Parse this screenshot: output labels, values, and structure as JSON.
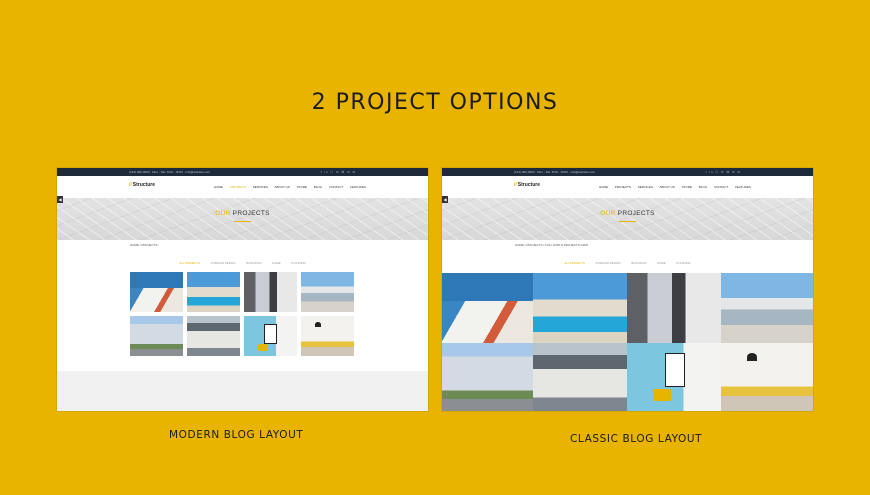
{
  "headline": "2 PROJECT OPTIONS",
  "captions": {
    "left": "MODERN BLOG LAYOUT",
    "right": "CLASSIC BLOG LAYOUT"
  },
  "site": {
    "contact_text": "(123) 000-0000 · Mon - Sat: 8:00 - 18:00 · info@website.com",
    "social_icons": "f in ☐ ✉ ⌘ ✉ ✉",
    "logo": "Structure",
    "menu": [
      "HOME",
      "PROJECTS",
      "SERVICES",
      "ABOUT US",
      "STORE",
      "BLOG",
      "CONTACT",
      "FEATURES"
    ],
    "active_menu": "PROJECTS",
    "hero_title_accent": "OUR",
    "hero_title_rest": " PROJECTS",
    "breadcrumb_left": "HOME / PROJECTS",
    "breadcrumb_right": "HOME / PROJECTS / FULL WIDTH PROJECTS GRID",
    "side_button": "◀",
    "filters": [
      "ALL PROJECTS",
      "INTERIOR DESIGN",
      "BUILDINGS",
      "HOME",
      "PLANNING"
    ]
  },
  "colors": {
    "background": "#E8B400",
    "accent": "#E8B400",
    "topbar": "#1E2A3A"
  }
}
